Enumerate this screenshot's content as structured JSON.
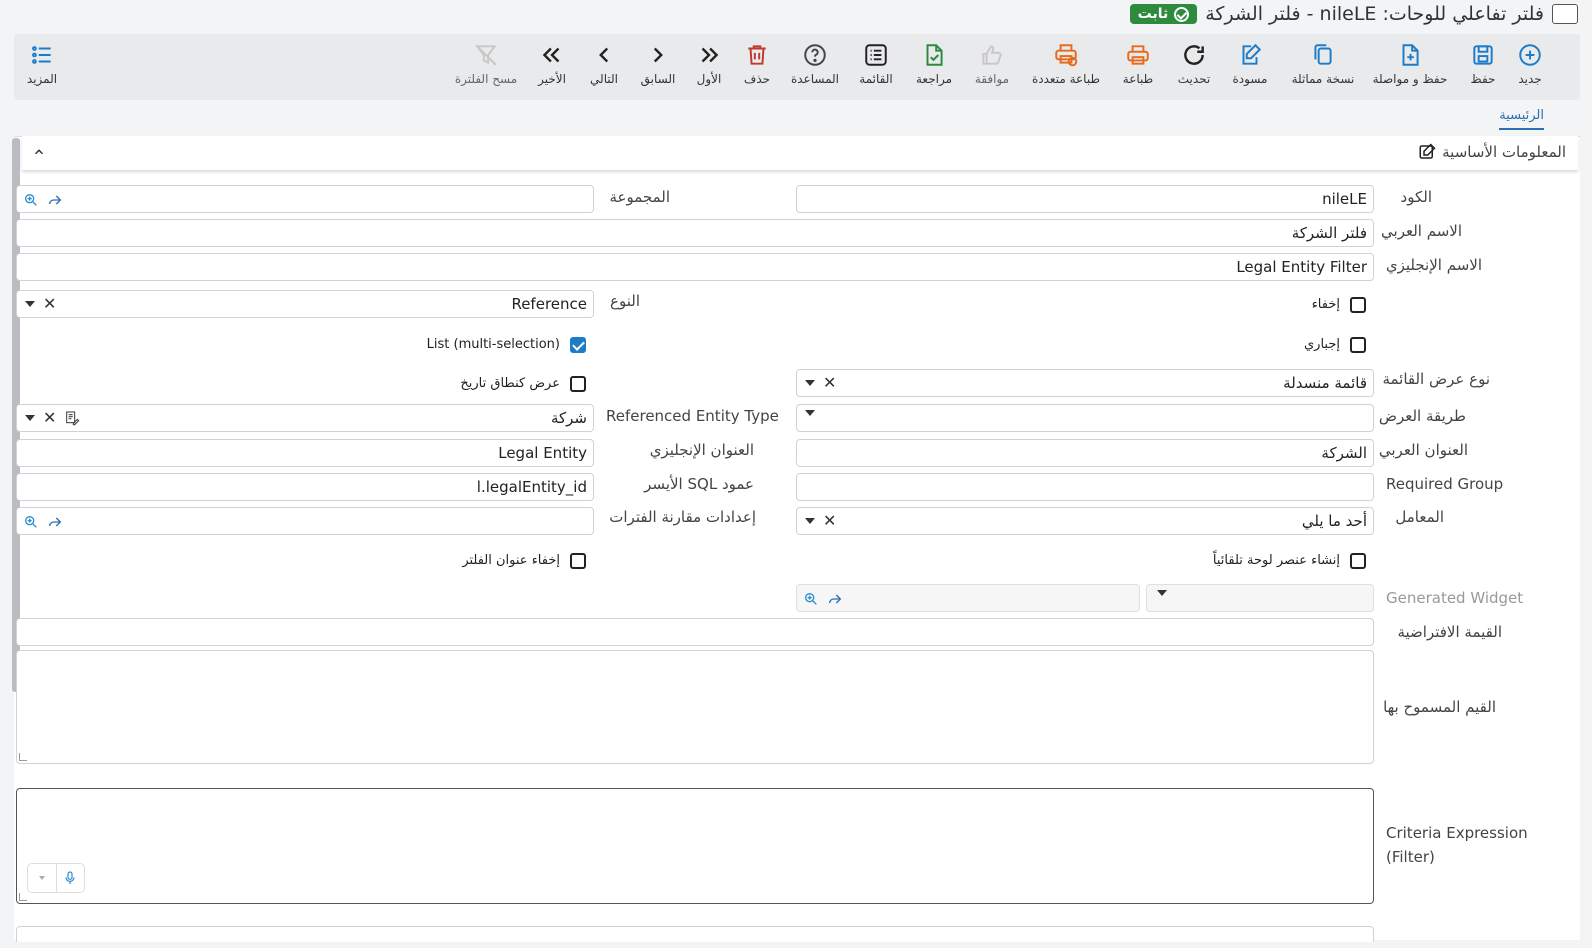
{
  "header": {
    "title": "فلتر تفاعلي للوحات: nileLE - فلتر الشركة",
    "status": "ثابت"
  },
  "toolbar": {
    "new": "جديد",
    "save": "حفظ",
    "save_continue": "حفظ و مواصلة",
    "duplicate": "نسخة مماثلة",
    "draft": "مسودة",
    "refresh": "تحديث",
    "print": "طباعة",
    "multi_print": "طباعة متعددة",
    "approve": "موافقة",
    "review": "مراجعة",
    "list": "القائمة",
    "help": "المساعدة",
    "delete": "حذف",
    "first": "الأول",
    "previous": "السابق",
    "next": "التالي",
    "last": "الأخير",
    "clear_filter": "مسح الفلترة",
    "more": "المزيد"
  },
  "tabs": {
    "main": "الرئيسية"
  },
  "section": {
    "title": "المعلومات الأساسية"
  },
  "form": {
    "code_label": "الكود",
    "code_value": "nileLE",
    "group_label": "المجموعة",
    "group_value": "",
    "arabic_name_label": "الاسم العربي",
    "arabic_name_value": "فلتر الشركة",
    "english_name_label": "الاسم الإنجليزي",
    "english_name_value": "Legal Entity Filter",
    "hide_label": "إخفاء",
    "hide_checked": false,
    "type_label": "النوع",
    "type_value": "Reference",
    "mandatory_label": "إجباري",
    "mandatory_checked": false,
    "list_multi_label": "List (multi-selection)",
    "list_multi_checked": true,
    "list_display_type_label": "نوع عرض القائمة",
    "list_display_type_value": "قائمة منسدلة",
    "date_range_label": "عرض كنطاق تاريخ",
    "date_range_checked": false,
    "display_method_label": "طريقة العرض",
    "display_method_value": "",
    "ref_entity_type_label": "Referenced Entity Type",
    "ref_entity_type_value": "شركة",
    "arabic_title_label": "العنوان العربي",
    "arabic_title_value": "الشركة",
    "english_title_label": "العنوان الإنجليزي",
    "english_title_value": "Legal Entity",
    "required_group_label": "Required Group",
    "required_group_value": "",
    "left_sql_column_label": "عمود SQL الأيسر",
    "left_sql_column_value": "l.legalEntity_id",
    "operator_label": "المعامل",
    "operator_value": "أحد ما يلي",
    "period_compare_label": "إعدادات مقارنة الفترات",
    "period_compare_value": "",
    "auto_widget_label": "إنشاء عنصر لوحة تلقائياً",
    "auto_widget_checked": false,
    "hide_filter_title_label": "إخفاء عنوان الفلتر",
    "hide_filter_title_checked": false,
    "generated_widget_label": "Generated Widget",
    "default_value_label": "القيمة الافتراضية",
    "default_value": "",
    "allowed_values_label": "القيم المسموح بها",
    "allowed_values": "",
    "criteria_label_line1": "Criteria Expression",
    "criteria_label_line2": "(Filter)"
  }
}
